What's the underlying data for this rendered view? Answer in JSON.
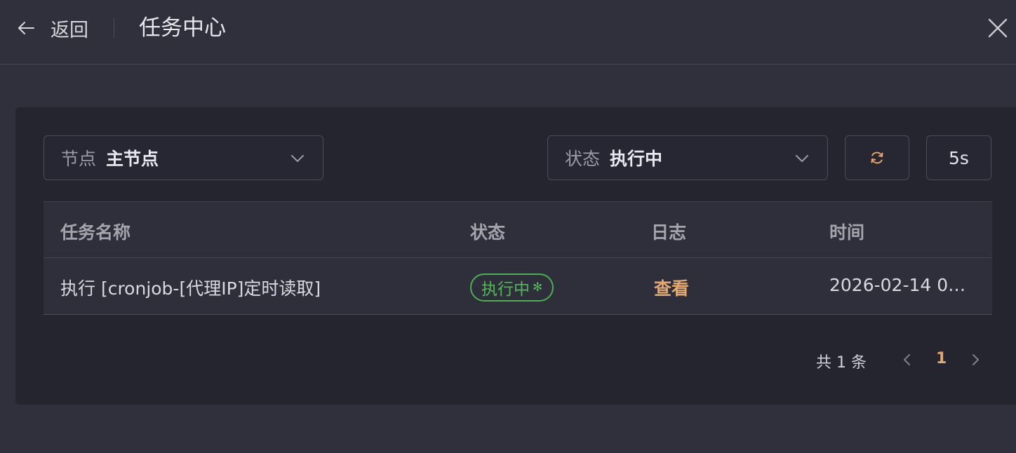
{
  "header": {
    "back_label": "返回",
    "title": "任务中心"
  },
  "filters": {
    "node": {
      "label": "节点",
      "value": "主节点"
    },
    "status": {
      "label": "状态",
      "value": "执行中"
    },
    "interval_label": "5s"
  },
  "table": {
    "columns": [
      "任务名称",
      "状态",
      "日志",
      "时间"
    ],
    "rows": [
      {
        "name": "执行 [cronjob-[代理IP]定时读取]",
        "status": "执行中",
        "log_link": "查看",
        "time": "2026-02-14 0…"
      }
    ]
  },
  "pagination": {
    "total_text": "共 1 条",
    "current_page": "1"
  },
  "colors": {
    "background": "#2f303b",
    "panel": "#24252f",
    "accent": "#e6a76d",
    "status_running": "#52b857"
  },
  "icons": {
    "back": "arrow-left-icon",
    "close": "close-icon",
    "dropdown": "chevron-down-icon",
    "refresh": "refresh-icon",
    "prev": "chevron-left-icon",
    "next": "chevron-right-icon",
    "spinner": "spinner-icon"
  }
}
